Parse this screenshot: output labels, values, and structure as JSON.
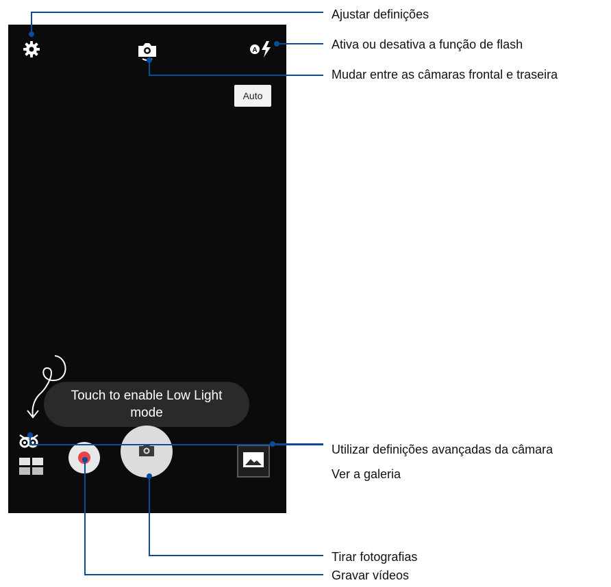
{
  "camera": {
    "flash_mode_button": "Auto",
    "low_light_hint": "Touch to enable Low Light mode"
  },
  "icons": {
    "settings": "gear-icon",
    "switch_camera": "switch-camera-icon",
    "flash": "flash-auto-icon",
    "low_light": "owl-icon",
    "modes": "grid-icon",
    "record": "record-icon",
    "shutter": "camera-icon",
    "gallery": "gallery-icon"
  },
  "callouts": {
    "settings": "Ajustar definições",
    "flash": "Ativa ou desativa a função de flash",
    "switch_camera": "Mudar entre as câmaras frontal e traseira",
    "advanced": "Utilizar definições avançadas da câmara",
    "gallery": "Ver a galeria",
    "take_photo": "Tirar fotografias",
    "record_video": "Gravar vídeos"
  },
  "colors": {
    "callout_line": "#0a4b9b",
    "record_red": "#e8434a",
    "viewfinder_bg": "#0b0b0b"
  }
}
